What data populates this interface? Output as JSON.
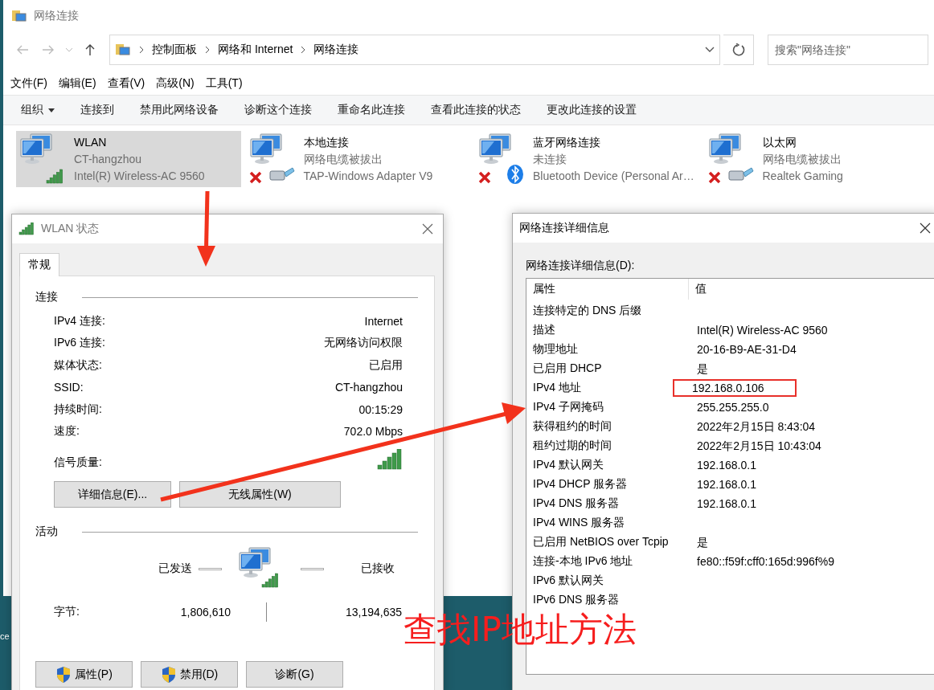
{
  "desktop": {
    "fragment": "ce"
  },
  "window": {
    "title": "网络连接"
  },
  "address_bar": {
    "breadcrumb": [
      "控制面板",
      "网络和 Internet",
      "网络连接"
    ]
  },
  "search": {
    "placeholder": "搜索\"网络连接\""
  },
  "menu": [
    "文件(F)",
    "编辑(E)",
    "查看(V)",
    "高级(N)",
    "工具(T)"
  ],
  "toolbar": [
    {
      "label": "组织",
      "kind": "menu"
    },
    {
      "label": "连接到",
      "kind": "command"
    },
    {
      "label": "禁用此网络设备",
      "kind": "command"
    },
    {
      "label": "诊断这个连接",
      "kind": "command"
    },
    {
      "label": "重命名此连接",
      "kind": "command"
    },
    {
      "label": "查看此连接的状态",
      "kind": "command"
    },
    {
      "label": "更改此连接的设置",
      "kind": "command"
    }
  ],
  "connections": [
    {
      "name": "WLAN",
      "status": "CT-hangzhou",
      "device": "Intel(R) Wireless-AC 9560",
      "kind": "wifi",
      "disconnected": false,
      "selected": true
    },
    {
      "name": "本地连接",
      "status": "网络电缆被拔出",
      "device": "TAP-Windows Adapter V9",
      "kind": "cable",
      "disconnected": true,
      "selected": false
    },
    {
      "name": "蓝牙网络连接",
      "status": "未连接",
      "device": "Bluetooth Device (Personal Ar…",
      "kind": "bluetooth",
      "disconnected": true,
      "selected": false
    },
    {
      "name": "以太网",
      "status": "网络电缆被拔出",
      "device": "Realtek Gaming",
      "kind": "cable",
      "disconnected": true,
      "selected": false
    }
  ],
  "status_dialog": {
    "title": "WLAN 状态",
    "tabs": [
      {
        "label": "常规",
        "selected": true
      }
    ],
    "connection_heading": "连接",
    "rows": [
      {
        "label": "IPv4 连接:",
        "value": "Internet"
      },
      {
        "label": "IPv6 连接:",
        "value": "无网络访问权限"
      },
      {
        "label": "媒体状态:",
        "value": "已启用"
      },
      {
        "label": "SSID:",
        "value": "CT-hangzhou"
      },
      {
        "label": "持续时间:",
        "value": "00:15:29"
      },
      {
        "label": "速度:",
        "value": "702.0 Mbps"
      }
    ],
    "signal_label": "信号质量:",
    "buttons": [
      "详细信息(E)...",
      "无线属性(W)"
    ],
    "activity_heading": "活动",
    "sent_label": "已发送",
    "received_label": "已接收",
    "bytes_label": "字节:",
    "bytes_sent": "1,806,610",
    "bytes_received": "13,194,635",
    "bottom_buttons": [
      {
        "label": "属性(P)",
        "shield": true
      },
      {
        "label": "禁用(D)",
        "shield": true
      },
      {
        "label": "诊断(G)",
        "shield": false
      }
    ]
  },
  "details_dialog": {
    "title": "网络连接详细信息",
    "list_label": "网络连接详细信息(D):",
    "columns": [
      "属性",
      "值"
    ],
    "rows": [
      {
        "property": "连接特定的 DNS 后缀",
        "value": "",
        "highlighted": false
      },
      {
        "property": "描述",
        "value": "Intel(R) Wireless-AC 9560",
        "highlighted": false
      },
      {
        "property": "物理地址",
        "value": "20-16-B9-AE-31-D4",
        "highlighted": false
      },
      {
        "property": "已启用 DHCP",
        "value": "是",
        "highlighted": false
      },
      {
        "property": "IPv4 地址",
        "value": "192.168.0.106",
        "highlighted": true
      },
      {
        "property": "IPv4 子网掩码",
        "value": "255.255.255.0",
        "highlighted": false
      },
      {
        "property": "获得租约的时间",
        "value": "2022年2月15日 8:43:04",
        "highlighted": false
      },
      {
        "property": "租约过期的时间",
        "value": "2022年2月15日 10:43:04",
        "highlighted": false
      },
      {
        "property": "IPv4 默认网关",
        "value": "192.168.0.1",
        "highlighted": false
      },
      {
        "property": "IPv4 DHCP 服务器",
        "value": "192.168.0.1",
        "highlighted": false
      },
      {
        "property": "IPv4 DNS 服务器",
        "value": "192.168.0.1",
        "highlighted": false
      },
      {
        "property": "IPv4 WINS 服务器",
        "value": "",
        "highlighted": false
      },
      {
        "property": "已启用 NetBIOS over Tcpip",
        "value": "是",
        "highlighted": false
      },
      {
        "property": "连接-本地 IPv6 地址",
        "value": "fe80::f59f:cff0:165d:996f%9",
        "highlighted": false
      },
      {
        "property": "IPv6 默认网关",
        "value": "",
        "highlighted": false
      },
      {
        "property": "IPv6 DNS 服务器",
        "value": "",
        "highlighted": false
      }
    ]
  },
  "annotation": {
    "text": "查找IP地址方法"
  }
}
